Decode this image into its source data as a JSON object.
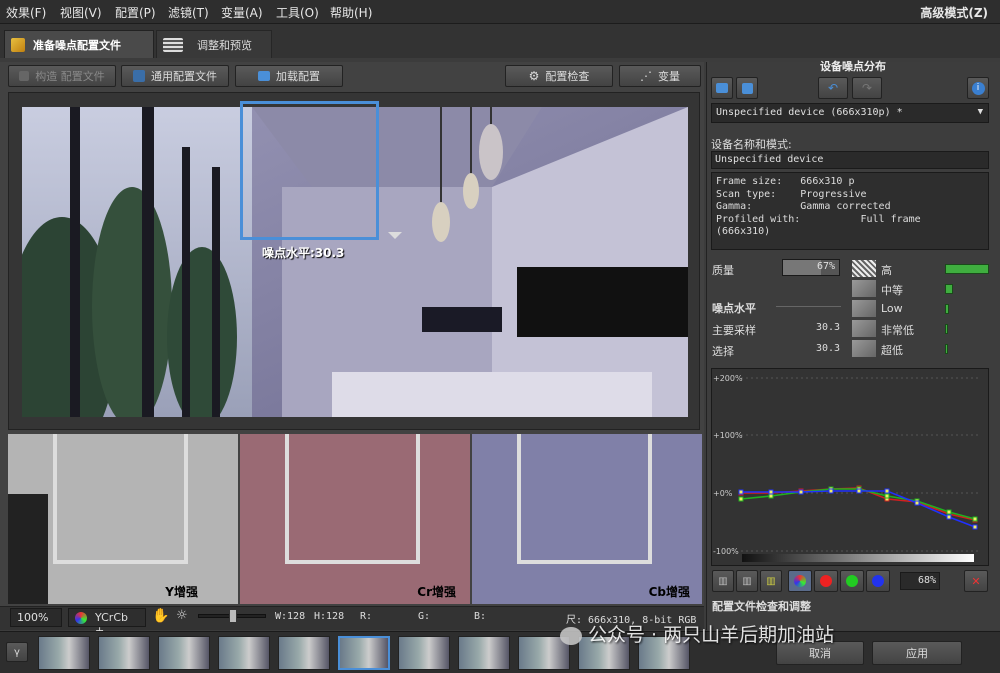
{
  "menu": {
    "items": [
      "效果(F)",
      "视图(V)",
      "配置(P)",
      "滤镜(T)",
      "变量(A)",
      "工具(O)",
      "帮助(H)"
    ],
    "mode": "高级模式(Z)"
  },
  "tabs": [
    {
      "label": "准备噪点配置文件"
    },
    {
      "label": "调整和预览"
    }
  ],
  "toolbar": {
    "auto_profile": "构造 配置文件",
    "generic_profile": "通用配置文件",
    "load_profile": "加载配置",
    "profile_check": "配置检查",
    "variables": "变量"
  },
  "preview": {
    "noise_label": "噪点水平:30.3"
  },
  "channels": [
    {
      "label": "Y增强"
    },
    {
      "label": "Cr增强"
    },
    {
      "label": "Cb增强"
    }
  ],
  "statusbar": {
    "zoom": "100%",
    "colorspace": "YCrCb +",
    "w": "W:128",
    "h": "H:128",
    "r": "R:",
    "g": "G:",
    "b": "B:",
    "info": "尺: 666x310, 8-bit RGB"
  },
  "right": {
    "title": "设备噪点分布",
    "device_select": "Unspecified device (666x310p) *",
    "name_label": "设备名称和模式:",
    "name_value": "Unspecified device",
    "info_lines": [
      "Frame size:   666x310 p",
      "Scan type:    Progressive",
      "Gamma:        Gamma corrected",
      "Profiled with:          Full frame",
      "(666x310)"
    ],
    "quality_label": "质量",
    "quality_value": "67%",
    "noise_level_label": "噪点水平",
    "main_sample_label": "主要采样",
    "main_sample_value": "30.3",
    "selection_label": "选择",
    "selection_value": "30.3",
    "levels": [
      {
        "label": "高",
        "value": 1.0
      },
      {
        "label": "中等",
        "value": 0.18
      },
      {
        "label": "Low",
        "value": 0.08
      },
      {
        "label": "非常低",
        "value": 0.04
      },
      {
        "label": "超低",
        "value": 0.03
      }
    ],
    "chart_ticks": [
      "+200%",
      "+100%",
      "+0%",
      "-100%"
    ],
    "percent": "68%",
    "section_label": "配置文件检查和调整"
  },
  "bottom": {
    "cancel": "取消",
    "apply": "应用"
  },
  "watermark": "公众号 · 两只山羊后期加油站",
  "colors": {
    "accent": "#4a8fd8",
    "green": "#3fae3f",
    "bg": "#3c3c3c"
  }
}
